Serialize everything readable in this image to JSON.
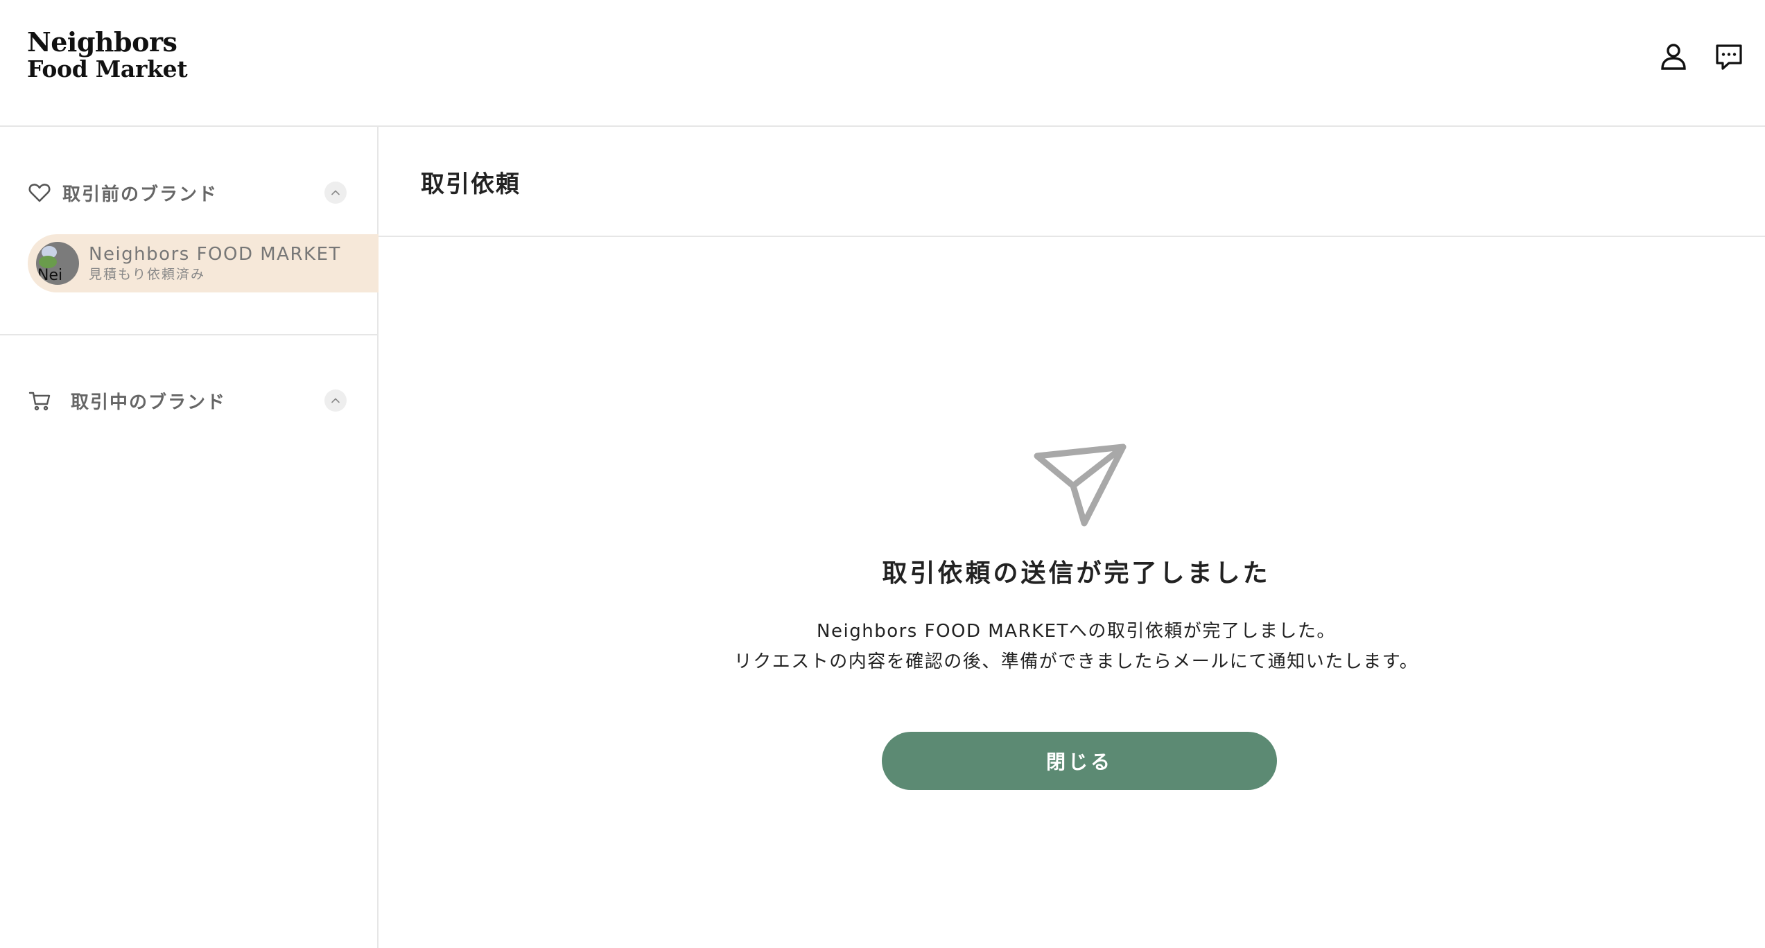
{
  "header": {
    "logo_line1": "Neighbors",
    "logo_line2": "Food Market",
    "account_icon": "user-icon",
    "messages_icon": "chat-icon"
  },
  "sidebar": {
    "pending_section": {
      "icon": "heart-icon",
      "title": "取引前のブランド",
      "items": [
        {
          "name": "Neighbors FOOD MARKET",
          "status": "見積もり依頼済み",
          "avatar_alt": "Nei"
        }
      ]
    },
    "active_section": {
      "icon": "cart-icon",
      "title": "取引中のブランド"
    }
  },
  "main": {
    "page_title": "取引依頼",
    "complete_title": "取引依頼の送信が完了しました",
    "message_line1": "Neighbors FOOD MARKETへの取引依頼が完了しました。",
    "message_line2": "リクエストの内容を確認の後、準備ができましたらメールにて通知いたします。",
    "close_button": "閉じる"
  },
  "colors": {
    "accent_green": "#5c8a73",
    "selected_bg": "#f6e8d9",
    "divider": "#e6e6e6"
  }
}
